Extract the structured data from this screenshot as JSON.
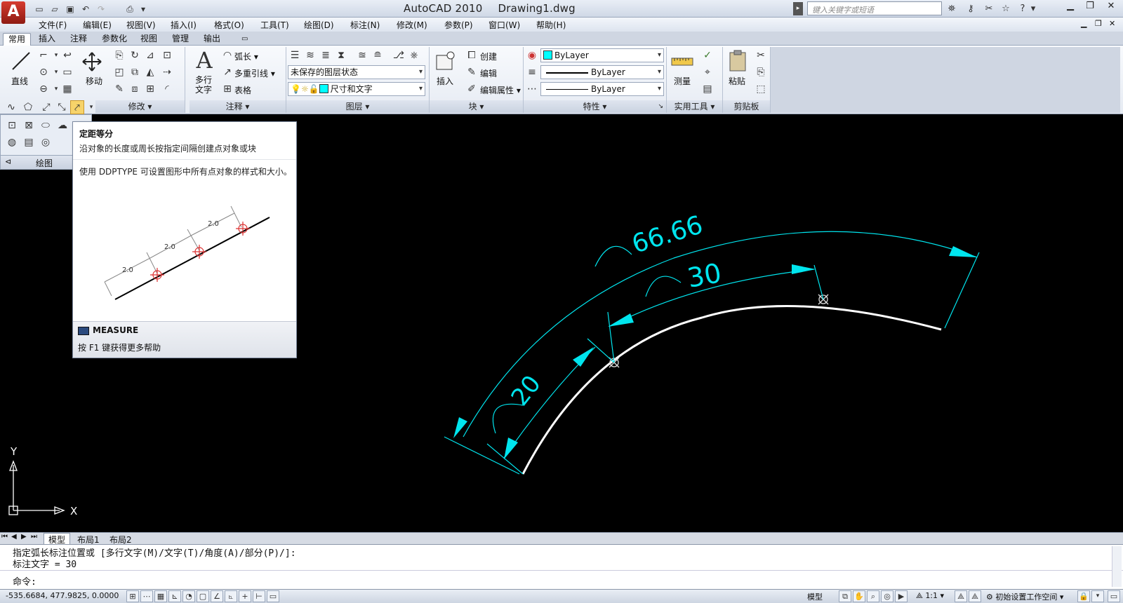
{
  "titlebar": {
    "app_logo": "A",
    "app_name": "AutoCAD 2010",
    "file_name": "Drawing1.dwg",
    "search_placeholder": "键入关键字或短语"
  },
  "menus": [
    "文件(F)",
    "编辑(E)",
    "视图(V)",
    "插入(I)",
    "格式(O)",
    "工具(T)",
    "绘图(D)",
    "标注(N)",
    "修改(M)",
    "参数(P)",
    "窗口(W)",
    "帮助(H)"
  ],
  "ribbon_tabs": [
    "常用",
    "插入",
    "注释",
    "参数化",
    "视图",
    "管理",
    "输出"
  ],
  "ribbon": {
    "draw": {
      "line": "直线",
      "title": "绘图"
    },
    "modify": {
      "move": "移动",
      "title": "修改"
    },
    "annotation": {
      "mtext_line1": "多行",
      "mtext_line2": "文字",
      "arc_length": "弧长",
      "multileader": "多重引线",
      "table": "表格",
      "title": "注释"
    },
    "layers": {
      "state": "未保存的图层状态",
      "current": "尺寸和文字",
      "title": "图层"
    },
    "block": {
      "insert": "插入",
      "create": "创建",
      "edit": "编辑",
      "edit_attr": "编辑属性",
      "title": "块"
    },
    "properties": {
      "color": "ByLayer",
      "linetype": "ByLayer",
      "lineweight": "ByLayer",
      "title": "特性"
    },
    "utilities": {
      "measure": "测量",
      "title": "实用工具"
    },
    "clipboard": {
      "paste": "粘贴",
      "title": "剪贴板"
    }
  },
  "tooltip": {
    "title": "定距等分",
    "description": "沿对象的长度或周长按指定间隔创建点对象或块",
    "note": "使用 DDPTYPE 可设置图形中所有点对象的样式和大小。",
    "illustration_labels": [
      "2.0",
      "2.0",
      "2.0"
    ],
    "command": "MEASURE",
    "help": "按 F1 键获得更多帮助"
  },
  "drawing": {
    "dim_outer": "66.66",
    "dim_middle": "30",
    "dim_inner": "20",
    "colors": {
      "dimension": "#00e5ee",
      "geometry": "#ffffff",
      "background": "#000000"
    }
  },
  "ucs": {
    "y": "Y",
    "x": "X"
  },
  "layout_tabs": [
    "模型",
    "布局1",
    "布局2"
  ],
  "command_line": {
    "history": [
      "指定弧长标注位置或 [多行文字(M)/文字(T)/角度(A)/部分(P)/]:",
      "标注文字 = 30"
    ],
    "prompt": "命令:"
  },
  "statusbar": {
    "coords": "-535.6684, 477.9825, 0.0000",
    "model": "模型",
    "scale": "1:1",
    "workspace": "初始设置工作空间"
  }
}
